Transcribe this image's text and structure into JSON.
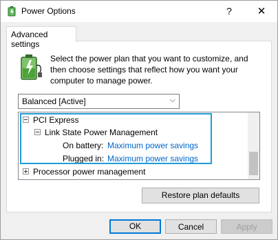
{
  "window": {
    "title": "Power Options",
    "help_glyph": "?",
    "close_glyph": "✕"
  },
  "tab": {
    "label": "Advanced settings"
  },
  "description": "Select the power plan that you want to customize, and then choose settings that reflect how you want your computer to manage power.",
  "plan_select": {
    "value": "Balanced [Active]"
  },
  "tree": {
    "pci": "PCI Express",
    "lspm": "Link State Power Management",
    "on_battery_label": "On battery:",
    "on_battery_value": "Maximum power savings",
    "plugged_label": "Plugged in:",
    "plugged_value": "Maximum power savings",
    "processor": "Processor power management"
  },
  "buttons": {
    "restore": "Restore plan defaults",
    "ok": "OK",
    "cancel": "Cancel",
    "apply": "Apply"
  },
  "colors": {
    "highlight": "#1e9bd6",
    "link": "#0066cc",
    "accent": "#0078d7"
  }
}
